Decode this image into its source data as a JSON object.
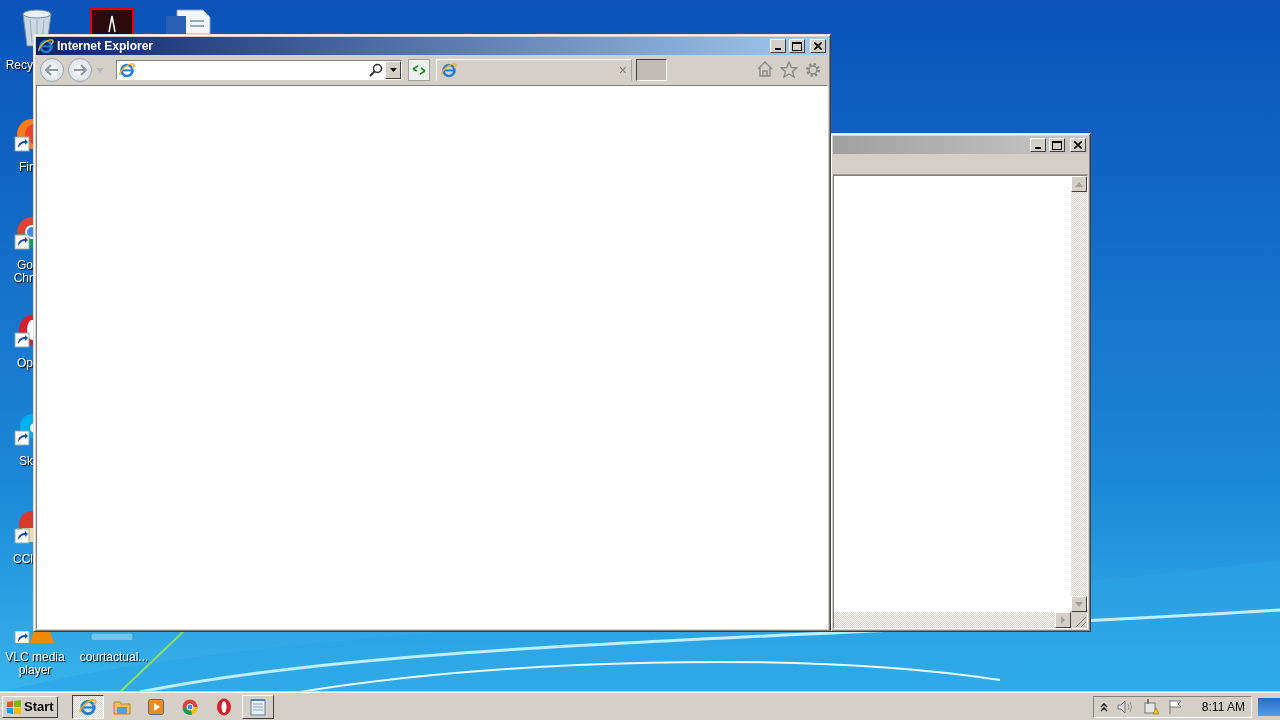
{
  "desktop": {
    "icons": [
      {
        "kind": "recycle-bin",
        "lines": [
          "Recy"
        ]
      },
      {
        "kind": "firefox",
        "lines": [
          "Fir"
        ]
      },
      {
        "kind": "chrome",
        "lines": [
          "Go",
          "Chr"
        ]
      },
      {
        "kind": "opera",
        "lines": [
          "Op"
        ]
      },
      {
        "kind": "skype",
        "lines": [
          "Sk"
        ]
      },
      {
        "kind": "ccleaner",
        "lines": [
          "CCl"
        ]
      },
      {
        "kind": "vlc",
        "lines": [
          "VLC media",
          "player"
        ]
      },
      {
        "kind": "pdf"
      },
      {
        "kind": "word"
      },
      {
        "kind": "file",
        "lines": [
          "courtactual..."
        ]
      }
    ]
  },
  "windows": [
    {
      "kind": "explorer",
      "active": false
    },
    {
      "kind": "browser",
      "active": true,
      "title": "Internet Explorer",
      "tab_close": "×"
    }
  ],
  "taskbar": {
    "start": "Start",
    "items": [
      {
        "kind": "ie",
        "task": true,
        "selected": true
      },
      {
        "kind": "folder",
        "task": false,
        "selected": false
      },
      {
        "kind": "media",
        "task": false,
        "selected": false
      },
      {
        "kind": "chrome",
        "task": false,
        "selected": false
      },
      {
        "kind": "opera",
        "task": false,
        "selected": false
      },
      {
        "kind": "notepad",
        "task": true,
        "selected": false
      }
    ],
    "clock": "8:11 AM"
  }
}
